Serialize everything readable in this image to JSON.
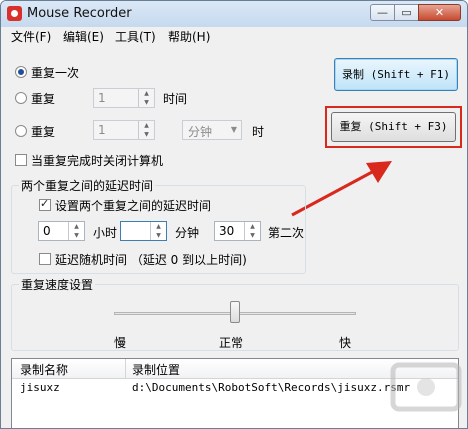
{
  "window": {
    "title": "Mouse Recorder",
    "min_glyph": "—",
    "max_glyph": "▭",
    "close_glyph": "✕"
  },
  "menu": [
    "文件(F)",
    "编辑(E)",
    "工具(T)",
    "帮助(H)"
  ],
  "repeat": {
    "once_label": "重复一次",
    "times_label": "重复",
    "times_value": "1",
    "times_unit": "时间",
    "interval_label": "重复",
    "interval_value": "1",
    "interval_unit_select": "分钟",
    "interval_suffix": "时"
  },
  "buttons": {
    "record": "录制 (Shift + F1)",
    "repeat": "重复 (Shift + F3)"
  },
  "shutdown_label": "当重复完成时关闭计算机",
  "delay": {
    "group_title": "两个重复之间的延迟时间",
    "set_delay_label": "设置两个重复之间的延迟时间",
    "hours_value": "0",
    "hours_label": "小时",
    "minutes_value": "",
    "minutes_label": "分钟",
    "seconds_value": "30",
    "seconds_label": "第二次",
    "random_label": "延迟随机时间 （延迟 0 到以上时间)"
  },
  "speed": {
    "group_title": "重复速度设置",
    "slow": "慢",
    "normal": "正常",
    "fast": "快",
    "level_fraction": 0.5
  },
  "list": {
    "columns": [
      "录制名称",
      "录制位置"
    ],
    "rows": [
      {
        "name": "jisuxz",
        "path": "d:\\Documents\\RobotSoft\\Records\\jisuxz.rsmr"
      }
    ]
  },
  "colors": {
    "highlight": "#d9281c",
    "title_bg": "#c6d9ee"
  }
}
